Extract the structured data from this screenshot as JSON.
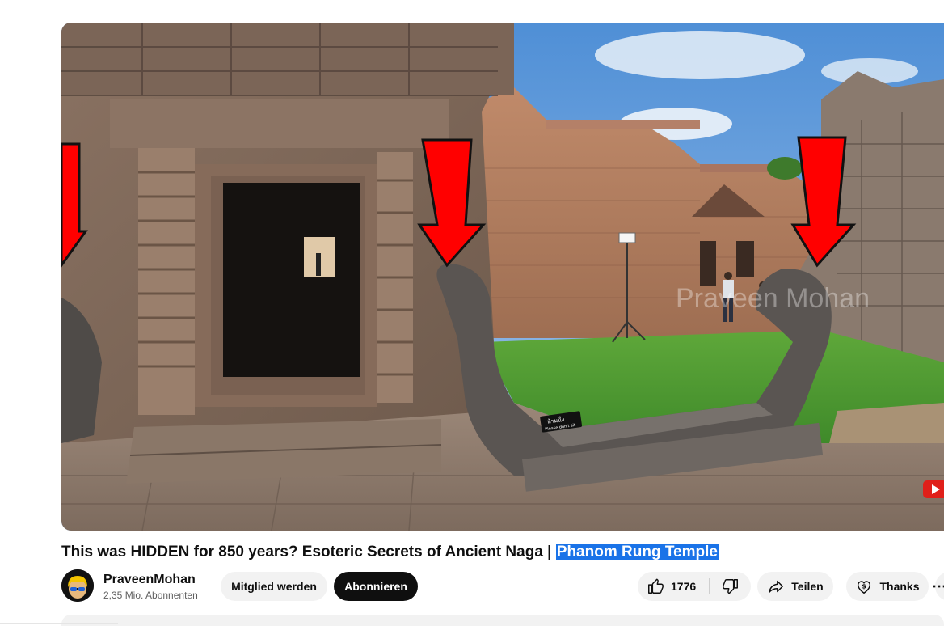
{
  "video": {
    "watermark": "Praveen Mohan",
    "sign_text_1": "ห้ามนั่ง",
    "sign_text_2": "Please don't sit"
  },
  "title": {
    "main": "This was HIDDEN for 850 years? Esoteric Secrets of Ancient Naga | ",
    "highlighted": "Phanom Rung Temple"
  },
  "channel": {
    "name": "PraveenMohan",
    "subscribers": "2,35 Mio. Abonnenten"
  },
  "actions": {
    "join_label": "Mitglied werden",
    "subscribe_label": "Abonnieren",
    "like_count": "1776",
    "share_label": "Teilen",
    "thanks_label": "Thanks"
  },
  "colors": {
    "accent_highlight": "#1a73e8",
    "subscribe_bg": "#0f0f0f",
    "pill_bg": "#f2f2f2",
    "arrow_red": "#ff0000"
  },
  "icons": [
    "thumbs-up-icon",
    "thumbs-down-icon",
    "share-icon",
    "thanks-icon",
    "more-icon"
  ]
}
